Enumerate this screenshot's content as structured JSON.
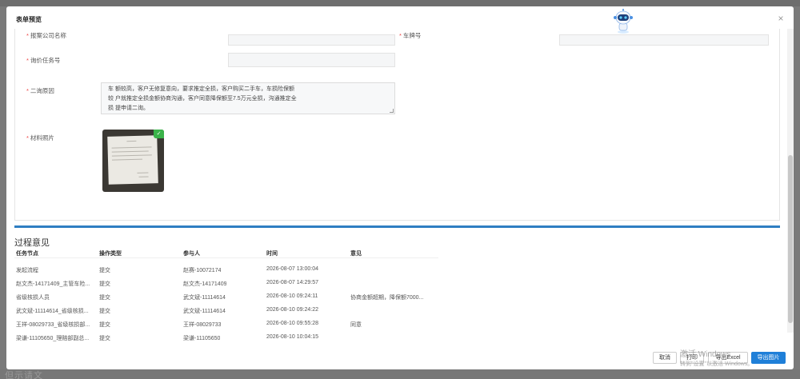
{
  "background": {
    "bottom_text": "但示请文"
  },
  "modal": {
    "title": "表单预览",
    "close_glyph": "×"
  },
  "form": {
    "company_label": "报案公司名称",
    "plate_label": "车牌号",
    "task_label": "询价任务号",
    "reason_label": "二询原因",
    "reason_lines": [
      "车                                                              额较高，客户无修复意向，要求推定全损，客户购买二手车，车损险保额",
      "较                                                              户就推定全损金额协商沟通，客户同意降保额至7.5万元全损，沟通推定全",
      "损                                                              提申请二询。"
    ],
    "photo_label": "材料照片",
    "photo_badge": "✓"
  },
  "process": {
    "title": "过程意见",
    "columns": [
      "任务节点",
      "操作类型",
      "参与人",
      "时间",
      "意见"
    ],
    "rows": [
      [
        "发起流程",
        "提交",
        "赵赛-10072174",
        "2026-08-07 13:00:04",
        ""
      ],
      [
        "赵文杰-14171409_主管车险...",
        "提交",
        "赵文杰-14171409",
        "2026-08-07 14:29:57",
        ""
      ],
      [
        "省级核损人员",
        "提交",
        "武文斌-11114614",
        "2026-08-10 09:24:11",
        "协商金额超期，降保额7000..."
      ],
      [
        "武文斌-11114614_省级核损...",
        "提交",
        "武文斌-11114614",
        "2026-08-10 09:24:22",
        ""
      ],
      [
        "王祥-08029733_省级核损部...",
        "提交",
        "王祥-08029733",
        "2026-08-10 09:55:28",
        "同意"
      ],
      [
        "梁谦-11105650_理赔部副总...",
        "提交",
        "梁谦-11105650",
        "2026-08-10 10:04:15",
        ""
      ]
    ]
  },
  "footer": {
    "cancel": "取消",
    "print": "打印",
    "export_excel": "导出Excel",
    "export_image": "导出图片"
  },
  "watermark": {
    "line1": "激活 Windows",
    "line2": "转到\"设置\"以激活 Windows。"
  },
  "colors": {
    "accent": "#2f7ec2",
    "primary_button": "#1f7fd8",
    "required": "#ee4444"
  }
}
